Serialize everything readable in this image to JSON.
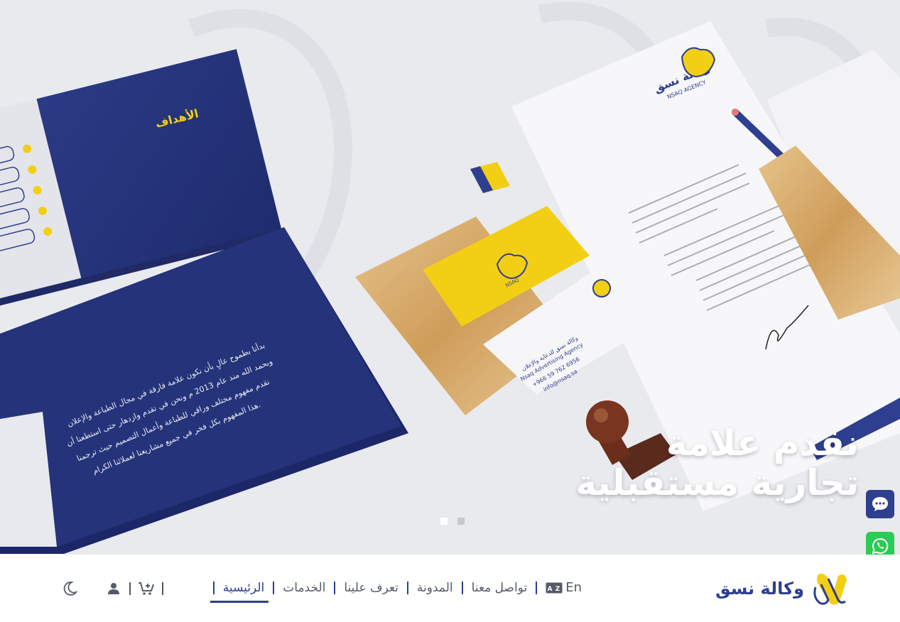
{
  "hero": {
    "headline_line1": "نقدم علامة",
    "headline_line2": "تجارية مستقبلية",
    "slides_count": 2,
    "active_slide": 1,
    "mockup": {
      "book_heading": "الأهداف",
      "book_paragraph": "بدأنا بطموح عالٍ بأن نكون علامة فارقة في مجال الطباعة والإعلان وبحمد الله منذ عام 2013 م ونحن في تقدم وازدهار حتى استطعنا أن نقدم مفهوم مختلف وراقي للطباعة وأعمال التصميم حيث ترجمنا هذا المفهوم بكل فخر في جميع مشاريعنا لعملائنا الكرام.",
      "letterhead_brand": "وكالة نسق",
      "letterhead_brand_en": "NSAQ AGENCY",
      "card_brand": "NSAQ",
      "card_name": "وكالة نسق للدعاية والإعلان",
      "card_name_en": "Nsaq Advertising Agency",
      "card_phone": "+966 59 762 6956",
      "card_email": "info@nsaq.sa"
    }
  },
  "floating": {
    "chat_icon": "chat-bubble-icon",
    "whatsapp_icon": "whatsapp-icon"
  },
  "nav": {
    "brand_name": "وكالة نسق",
    "items": [
      {
        "label": "الرئيسية",
        "active": true
      },
      {
        "label": "الخدمات",
        "active": false
      },
      {
        "label": "تعرف علينا",
        "active": false
      },
      {
        "label": "المدونة",
        "active": false
      },
      {
        "label": "تواصل معنا",
        "active": false
      }
    ],
    "lang_label": "En",
    "icons": [
      "translate-icon",
      "cart-icon",
      "user-icon",
      "moon-icon"
    ]
  },
  "colors": {
    "brand_blue": "#2e3f8f",
    "brand_yellow": "#f2cf14",
    "whatsapp_green": "#2bcb55"
  }
}
